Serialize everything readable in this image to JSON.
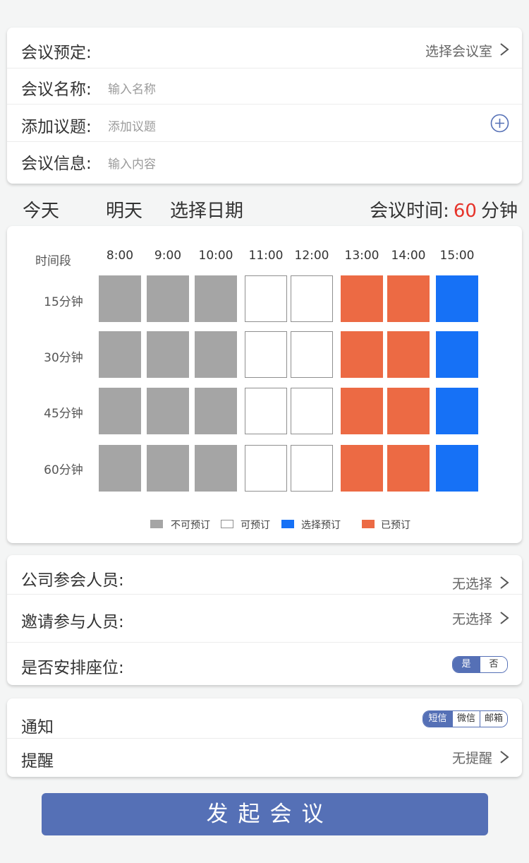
{
  "form": {
    "booking_label": "会议预定:",
    "room_select": "选择会议室",
    "name_label": "会议名称:",
    "name_placeholder": "输入名称",
    "topic_label": "添加议题:",
    "topic_placeholder": "添加议题",
    "info_label": "会议信息:",
    "info_placeholder": "输入内容"
  },
  "datebar": {
    "today": "今天",
    "tomorrow": "明天",
    "choose_date": "选择日期",
    "meeting_time_label": "会议时间:",
    "meeting_time_value": "60",
    "meeting_time_unit": "分钟"
  },
  "grid": {
    "header_label": "时间段",
    "times": [
      "8:00",
      "9:00",
      "10:00",
      "11:00",
      "12:00",
      "13:00",
      "14:00",
      "15:00"
    ],
    "durations": [
      "15分钟",
      "30分钟",
      "45分钟",
      "60分钟"
    ],
    "status_by_column": [
      "unavailable",
      "unavailable",
      "unavailable",
      "available",
      "available",
      "booked",
      "booked",
      "selected"
    ],
    "legend": {
      "unavailable": "不可预订",
      "available": "可预订",
      "selected": "选择预订",
      "booked": "已预订"
    },
    "colors": {
      "unavailable": "#a5a5a5",
      "available": "#ffffff",
      "selected": "#1671f6",
      "booked": "#ec6a44"
    }
  },
  "participants": {
    "company_label": "公司参会人员:",
    "company_value": "无选择",
    "invite_label": "邀请参与人员:",
    "invite_value": "无选择",
    "seating_label": "是否安排座位:",
    "seating_yes": "是",
    "seating_no": "否",
    "seating_selected": "是"
  },
  "notify": {
    "notify_label": "通知",
    "sms": "短信",
    "wechat": "微信",
    "email": "邮箱",
    "notify_selected": "短信",
    "remind_label": "提醒",
    "remind_value": "无提醒"
  },
  "submit_label": "发起会议",
  "accent_color": "#5570b6",
  "highlight_color": "#e6332a"
}
